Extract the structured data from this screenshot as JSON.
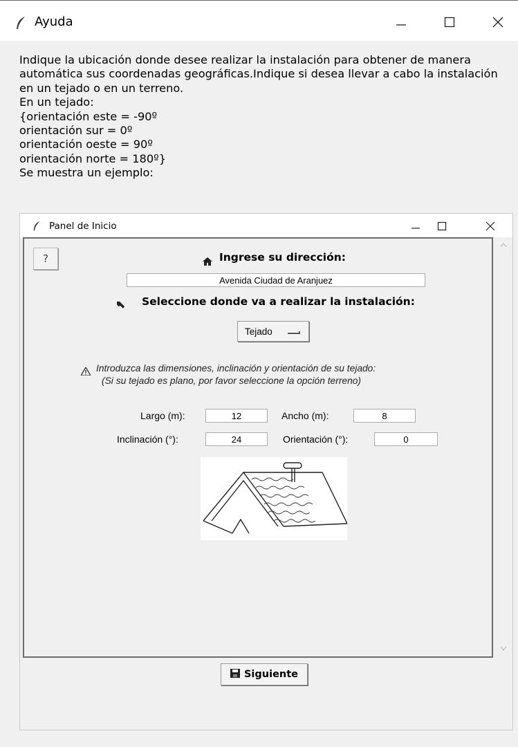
{
  "window": {
    "title": "Ayuda",
    "icon": "feather-icon",
    "controls": [
      "minimize-icon",
      "maximize-icon",
      "close-icon"
    ]
  },
  "help_text": "Indique la ubicación donde desee realizar la instalación para obtener de manera automática sus coordenadas geográficas.Indique si desea llevar a cabo la instalación en un tejado o en un terreno.\nEn un tejado:\n{orientación este = -90º\norientación sur = 0º\norientación oeste = 90º\norientación norte = 180º}\nSe muestra un ejemplo:",
  "inner_window": {
    "title": "Panel de Inicio",
    "help_button_label": "?",
    "address_label": "Ingrese su dirección:",
    "address_value": "Avenida Ciudad de Aranjuez",
    "install_label": "Seleccione donde va a realizar la instalación:",
    "install_select": "Tejado",
    "instructions_line1": "Introduzca las dimensiones, inclinación y orientación de su tejado:",
    "instructions_line2": "(Si su tejado es plano, por favor seleccione la opción terreno)",
    "fields": {
      "largo_label": "Largo (m):",
      "largo_value": "12",
      "ancho_label": "Ancho (m):",
      "ancho_value": "8",
      "inclinacion_label": "Inclinación (°):",
      "inclinacion_value": "24",
      "orientacion_label": "Orientación (°):",
      "orientacion_value": "0"
    },
    "next_button": "Siguiente"
  }
}
